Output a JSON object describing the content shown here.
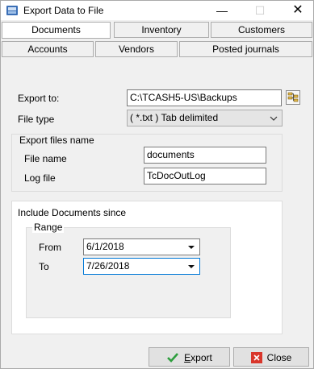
{
  "window": {
    "title": "Export Data to File",
    "minimize_glyph": "—",
    "maximize_glyph": "☐",
    "close_glyph": "✕"
  },
  "tabs": {
    "row1": [
      {
        "label": "Documents",
        "active": true
      },
      {
        "label": "Inventory",
        "active": false
      },
      {
        "label": "Customers",
        "active": false
      }
    ],
    "row2": [
      {
        "label": "Accounts",
        "active": false
      },
      {
        "label": "Vendors",
        "active": false
      },
      {
        "label": "Posted journals",
        "active": false
      }
    ]
  },
  "form": {
    "export_to_label": "Export to:",
    "export_to_value": "C:\\TCASH5-US\\Backups",
    "file_type_label": "File type",
    "file_type_value": "( *.txt )   Tab delimited",
    "export_files_name_label": "Export files name",
    "file_name_label": "File name",
    "file_name_value": "documents",
    "log_file_label": "Log file",
    "log_file_value": "TcDocOutLog",
    "include_label": "Include Documents since",
    "range_label": "Range",
    "from_label": "From",
    "from_value": "6/1/2018",
    "to_label": "To",
    "to_value": "7/26/2018"
  },
  "buttons": {
    "export_first": "E",
    "export_rest": "xport",
    "close": "Close"
  },
  "colors": {
    "export_check": "#2e9e3e",
    "close_red": "#d9362b",
    "focus": "#0078d7"
  }
}
